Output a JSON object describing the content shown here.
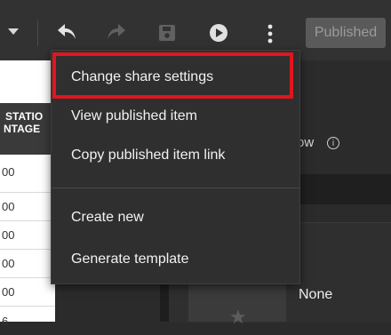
{
  "toolbar": {
    "icons": [
      "dropdown-caret-icon",
      "undo-icon",
      "redo-icon",
      "save-icon",
      "play-icon",
      "more-options-icon"
    ],
    "published_label": "Published"
  },
  "table": {
    "header_lines": [
      "STATIO",
      "NTAGE"
    ],
    "rows": [
      "00",
      "00",
      "00",
      "00",
      "00",
      "6"
    ]
  },
  "menu": {
    "items": [
      {
        "label": "Change share settings"
      },
      {
        "label": "View published item"
      },
      {
        "label": "Copy published item link"
      },
      {
        "label": "Create new"
      },
      {
        "label": "Generate template"
      }
    ],
    "highlight_color": "#e0151d"
  },
  "right_panel": {
    "ow_text": "ow",
    "info_icon": "i",
    "none_text": "None"
  }
}
